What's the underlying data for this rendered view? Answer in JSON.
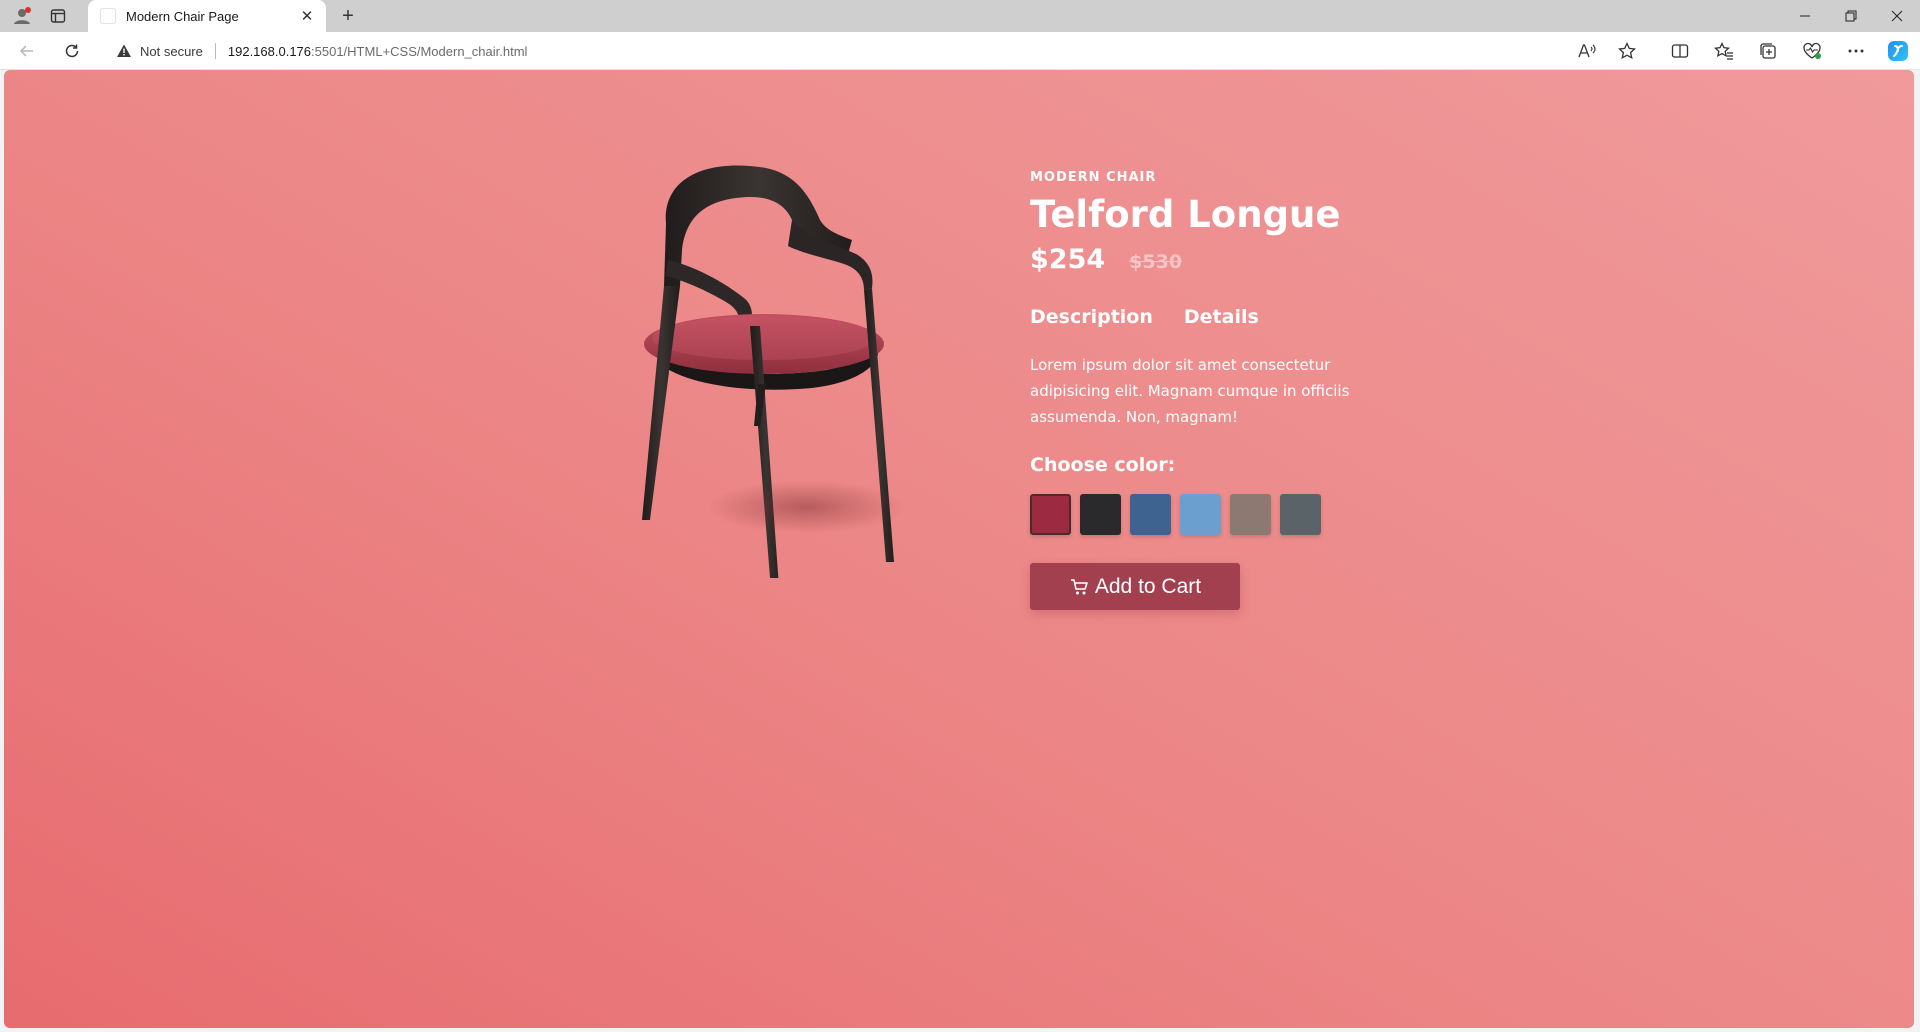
{
  "browser": {
    "tab_title": "Modern Chair Page",
    "new_tab_symbol": "+",
    "security_label": "Not secure",
    "url_host": "192.168.0.176",
    "url_path": ":5501/HTML+CSS/Modern_chair.html"
  },
  "product": {
    "eyebrow": "MODERN CHAIR",
    "title": "Telford Longue",
    "price": "$254",
    "old_price": "$530",
    "tabs": [
      "Description",
      "Details"
    ],
    "description": "Lorem ipsum dolor sit amet consectetur adipisicing elit. Magnam cumque in officiis assumenda. Non, magnam!",
    "color_label": "Choose color:",
    "colors": [
      {
        "name": "red",
        "hex": "#9c2a40",
        "selected": true
      },
      {
        "name": "black",
        "hex": "#2a2a2c",
        "selected": false
      },
      {
        "name": "navy-blue",
        "hex": "#3f6390",
        "selected": false
      },
      {
        "name": "light-blue",
        "hex": "#6a9fd0",
        "selected": false
      },
      {
        "name": "taupe",
        "hex": "#8c7a72",
        "selected": false
      },
      {
        "name": "slate-gray",
        "hex": "#5a6468",
        "selected": false
      }
    ],
    "cart_label": "Add to Cart"
  },
  "theme": {
    "background_top": "#f09a9c",
    "background_bottom": "#e76b6f",
    "accent": "#a2404f",
    "chair_frame": "#2e2a29",
    "chair_seat": "#b0404f"
  }
}
